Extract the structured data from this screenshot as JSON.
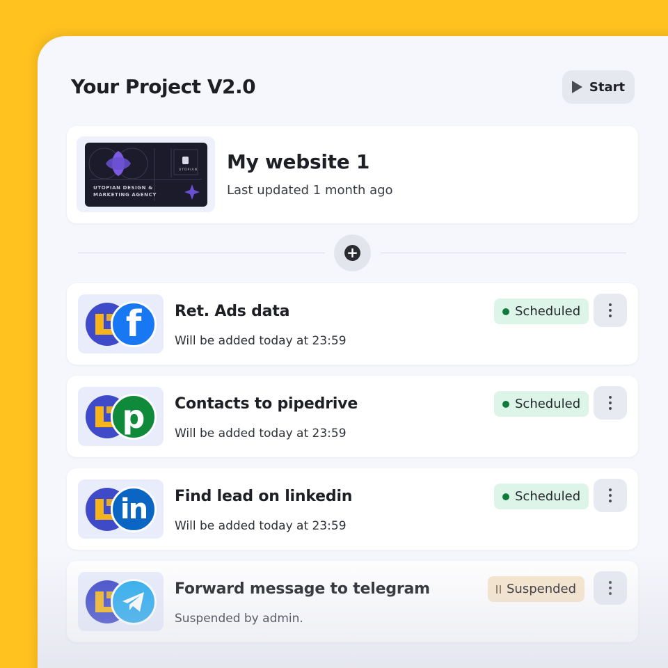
{
  "project": {
    "title": "Your Project V2.0",
    "start_label": "Start"
  },
  "website": {
    "name": "My website 1",
    "updated": "Last updated 1 month ago",
    "thumbnail_line1": "UTOPIAN DESIGN &",
    "thumbnail_line2": "MARKETING AGENCY",
    "thumbnail_brand": "UTOPIAN"
  },
  "add_step_icon": "plus-circle-icon",
  "tasks": [
    {
      "title": "Ret. Ads data",
      "subtitle": "Will be added today at 23:59",
      "status": "Scheduled",
      "integration_icon": "facebook-icon",
      "integration_color": "#1877F2"
    },
    {
      "title": "Contacts to pipedrive",
      "subtitle": "Will be added today at 23:59",
      "status": "Scheduled",
      "integration_icon": "pipedrive-icon",
      "integration_color": "#0E8A3A"
    },
    {
      "title": "Find lead on linkedin",
      "subtitle": "Will be added today at 23:59",
      "status": "Scheduled",
      "integration_icon": "linkedin-icon",
      "integration_color": "#0A66C2"
    },
    {
      "title": "Forward message to telegram",
      "subtitle": "Suspended by admin.",
      "status": "Suspended",
      "integration_icon": "telegram-icon",
      "integration_color": "#2AABEE"
    }
  ],
  "colors": {
    "background": "#FFC21F",
    "panel": "#F6F7FC",
    "scheduled_badge": "#DDF5E8",
    "scheduled_dot": "#0F7A3A",
    "suspended_badge": "#F7E6CC"
  }
}
